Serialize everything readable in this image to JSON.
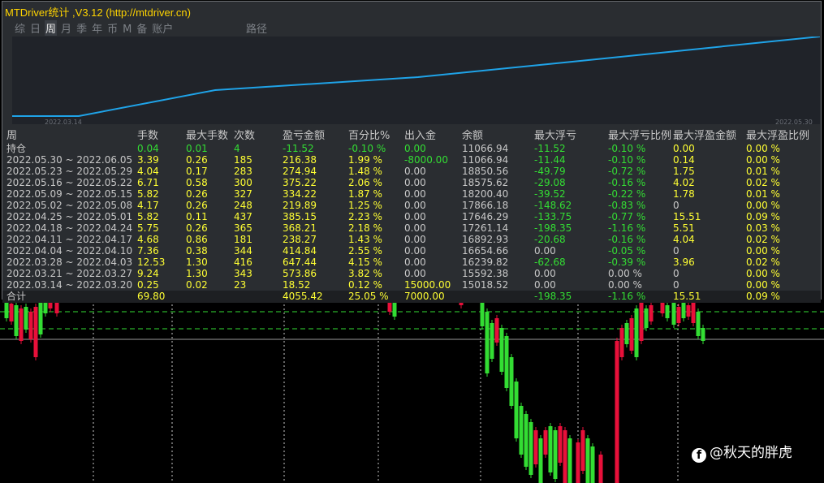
{
  "window": {
    "title": "MTDriver统计 ,V3.12 (http://mtdriver.cn)"
  },
  "tabs": [
    "综",
    "日",
    "周",
    "月",
    "季",
    "年",
    "币",
    "M",
    "备",
    "账户"
  ],
  "active_tab": "周",
  "path_tab": "路径",
  "mini_chart": {
    "start_date": "2022.03.14",
    "end_date": "2022.05.30",
    "line_color": "#1fa3e8"
  },
  "table": {
    "headers": [
      "周",
      "手数",
      "最大手数",
      "次数",
      "盈亏金额",
      "百分比%",
      "出入金",
      "余额",
      "最大浮亏",
      "最大浮亏比例",
      "最大浮盈金额",
      "最大浮盈比例"
    ],
    "rows": [
      {
        "label": "持仓",
        "cells": [
          "0.04",
          "0.01",
          "4",
          "-11.52",
          "-0.10 %",
          "0.00",
          "11066.94",
          "-11.52",
          "-0.10 %",
          "0.00",
          "0.00 %"
        ]
      },
      {
        "label": "2022.05.30 ~ 2022.06.05",
        "cells": [
          "3.39",
          "0.26",
          "185",
          "216.38",
          "1.99 %",
          "-8000.00",
          "11066.94",
          "-11.44",
          "-0.10 %",
          "0.14",
          "0.00 %"
        ]
      },
      {
        "label": "2022.05.23 ~ 2022.05.29",
        "cells": [
          "4.04",
          "0.17",
          "283",
          "274.94",
          "1.48 %",
          "0.00",
          "18850.56",
          "-49.79",
          "-0.72 %",
          "1.75",
          "0.01 %"
        ]
      },
      {
        "label": "2022.05.16 ~ 2022.05.22",
        "cells": [
          "6.71",
          "0.58",
          "300",
          "375.22",
          "2.06 %",
          "0.00",
          "18575.62",
          "-29.08",
          "-0.16 %",
          "4.02",
          "0.02 %"
        ]
      },
      {
        "label": "2022.05.09 ~ 2022.05.15",
        "cells": [
          "5.82",
          "0.26",
          "327",
          "334.22",
          "1.87 %",
          "0.00",
          "18200.40",
          "-39.52",
          "-0.22 %",
          "1.78",
          "0.01 %"
        ]
      },
      {
        "label": "2022.05.02 ~ 2022.05.08",
        "cells": [
          "4.17",
          "0.26",
          "248",
          "219.89",
          "1.25 %",
          "0.00",
          "17866.18",
          "-148.62",
          "-0.83 %",
          "0",
          "0.00 %"
        ]
      },
      {
        "label": "2022.04.25 ~ 2022.05.01",
        "cells": [
          "5.82",
          "0.11",
          "437",
          "385.15",
          "2.23 %",
          "0.00",
          "17646.29",
          "-133.75",
          "-0.77 %",
          "15.51",
          "0.09 %"
        ]
      },
      {
        "label": "2022.04.18 ~ 2022.04.24",
        "cells": [
          "5.75",
          "0.26",
          "365",
          "368.21",
          "2.18 %",
          "0.00",
          "17261.14",
          "-198.35",
          "-1.16 %",
          "5.51",
          "0.03 %"
        ]
      },
      {
        "label": "2022.04.11 ~ 2022.04.17",
        "cells": [
          "4.68",
          "0.86",
          "181",
          "238.27",
          "1.43 %",
          "0.00",
          "16892.93",
          "-20.68",
          "-0.16 %",
          "4.04",
          "0.02 %"
        ]
      },
      {
        "label": "2022.04.04 ~ 2022.04.10",
        "cells": [
          "7.36",
          "0.38",
          "344",
          "414.84",
          "2.55 %",
          "0.00",
          "16654.66",
          "0.00",
          "-0.05 %",
          "0",
          "0.00 %"
        ]
      },
      {
        "label": "2022.03.28 ~ 2022.04.03",
        "cells": [
          "12.53",
          "1.30",
          "416",
          "647.44",
          "4.15 %",
          "0.00",
          "16239.82",
          "-62.68",
          "-0.39 %",
          "3.96",
          "0.02 %"
        ]
      },
      {
        "label": "2022.03.21 ~ 2022.03.27",
        "cells": [
          "9.24",
          "1.30",
          "343",
          "573.86",
          "3.82 %",
          "0.00",
          "15592.38",
          "0.00",
          "0.00 %",
          "0",
          "0.00 %"
        ]
      },
      {
        "label": "2022.03.14 ~ 2022.03.20",
        "cells": [
          "0.25",
          "0.02",
          "23",
          "18.52",
          "0.12 %",
          "15000.00",
          "15018.52",
          "0.00",
          "0.00 %",
          "0",
          "0.00 %"
        ]
      }
    ],
    "total": {
      "label": "合计",
      "cells": [
        "69.80",
        "",
        "",
        "4055.42",
        "25.05 %",
        "7000.00",
        "",
        "-198.35",
        "-1.16 %",
        "15.51",
        "0.09 %"
      ]
    }
  },
  "colors": {
    "green": "#33dd33",
    "red": "#e8103a",
    "yellow": "#ffff33",
    "panel": "#2a2d31"
  },
  "watermark": "@秋天的胖虎"
}
